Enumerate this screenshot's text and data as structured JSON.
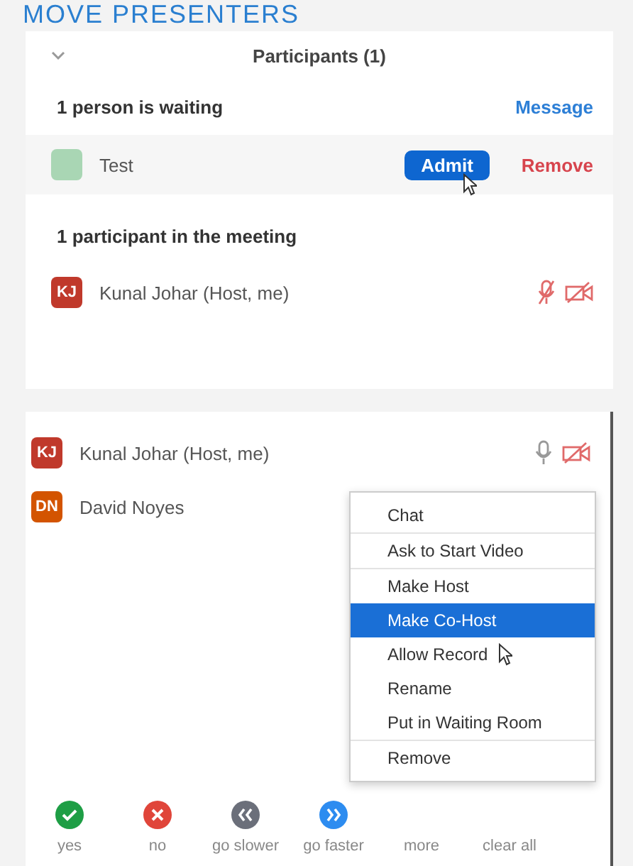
{
  "banner": "MOVE PRESENTERS",
  "panel": {
    "title": "Participants (1)",
    "expanded": true,
    "waiting": {
      "heading": "1 person is waiting",
      "action": "Message",
      "people": [
        {
          "name": "Test",
          "color": "#a9d6b4",
          "admit": "Admit",
          "remove": "Remove"
        }
      ]
    },
    "meeting": {
      "heading": "1 participant in the meeting",
      "people": [
        {
          "initials": "KJ",
          "name": "Kunal Johar (Host, me)",
          "color": "#c0392b",
          "mic_muted": true,
          "video_off": true
        }
      ]
    }
  },
  "list": {
    "people": [
      {
        "initials": "KJ",
        "name": "Kunal Johar (Host, me)",
        "color": "#c0392b",
        "mic_muted": false,
        "video_off": true
      },
      {
        "initials": "DN",
        "name": "David Noyes",
        "color": "#d35400"
      }
    ]
  },
  "menu": [
    {
      "label": "Chat",
      "selected": false
    },
    {
      "label": "Ask to Start Video",
      "selected": false
    },
    {
      "label": "Make Host",
      "selected": false
    },
    {
      "label": "Make Co-Host",
      "selected": true
    },
    {
      "label": "Allow Record",
      "selected": false
    },
    {
      "label": "Rename",
      "selected": false
    },
    {
      "label": "Put in Waiting Room",
      "selected": false
    },
    {
      "label": "Remove",
      "selected": false
    }
  ],
  "reactions": [
    {
      "kind": "yes",
      "label": "yes"
    },
    {
      "kind": "no",
      "label": "no"
    },
    {
      "kind": "slower",
      "label": "go slower"
    },
    {
      "kind": "faster",
      "label": "go faster"
    },
    {
      "kind": "hidden",
      "label": "more"
    },
    {
      "kind": "hidden",
      "label": "clear all"
    }
  ]
}
